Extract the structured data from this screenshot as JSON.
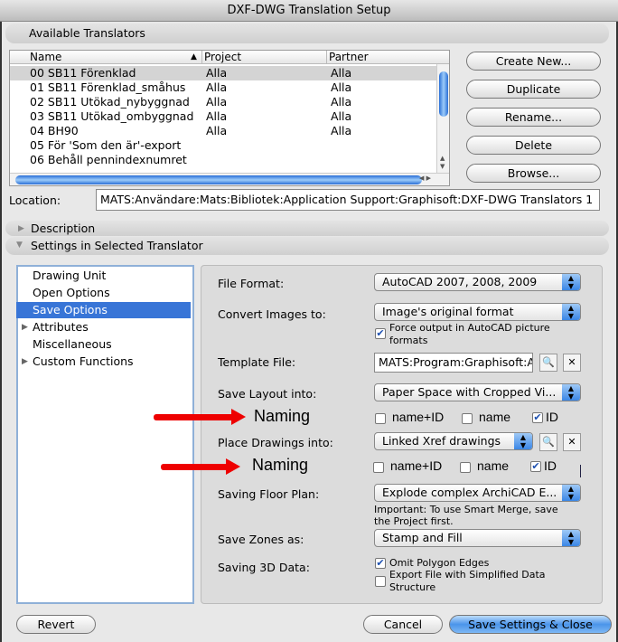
{
  "window": {
    "title": "DXF-DWG Translation Setup"
  },
  "available": {
    "header": "Available Translators",
    "columns": [
      "Name",
      "Project",
      "Partner"
    ],
    "rows": [
      {
        "name": "00 SB11 Förenklad",
        "project": "Alla",
        "partner": "Alla"
      },
      {
        "name": "01 SB11 Förenklad_småhus",
        "project": "Alla",
        "partner": "Alla"
      },
      {
        "name": "02 SB11 Utökad_nybyggnad",
        "project": "Alla",
        "partner": "Alla"
      },
      {
        "name": "03 SB11 Utökad_ombyggnad",
        "project": "Alla",
        "partner": "Alla"
      },
      {
        "name": "04 BH90",
        "project": "Alla",
        "partner": "Alla"
      },
      {
        "name": "05 För 'Som den är'-export",
        "project": "",
        "partner": ""
      },
      {
        "name": "06 Behåll pennindexnumret",
        "project": "",
        "partner": ""
      }
    ],
    "buttons": {
      "create": "Create New...",
      "duplicate": "Duplicate",
      "rename": "Rename...",
      "delete": "Delete",
      "browse": "Browse..."
    },
    "location_label": "Location:",
    "location_value": "MATS:Användare:Mats:Bibliotek:Application Support:Graphisoft:DXF-DWG Translators 1"
  },
  "sections": {
    "description": "Description",
    "settings": "Settings in Selected Translator"
  },
  "sidebar": {
    "items": [
      "Drawing Unit",
      "Open Options",
      "Save Options",
      "Attributes",
      "Miscellaneous",
      "Custom Functions"
    ]
  },
  "options": {
    "file_format": {
      "label": "File Format:",
      "value": "AutoCAD 2007, 2008, 2009"
    },
    "convert_images": {
      "label": "Convert Images to:",
      "value": "Image's original format",
      "checkbox": "Force output in AutoCAD picture formats"
    },
    "template": {
      "label": "Template File:",
      "value": "MATS:Program:Graphisoft:A"
    },
    "save_layout": {
      "label": "Save Layout into:",
      "value": "Paper Space with Cropped Vi..."
    },
    "naming1": {
      "label": "Naming",
      "opts": [
        "name+ID",
        "name",
        "ID"
      ]
    },
    "place_drawings": {
      "label": "Place Drawings into:",
      "value": "Linked Xref drawings"
    },
    "naming2": {
      "label": "Naming",
      "opts": [
        "name+ID",
        "name",
        "ID"
      ]
    },
    "floor_plan": {
      "label": "Saving Floor Plan:",
      "value": "Explode complex ArchiCAD E...",
      "note": "Important: To use Smart Merge, save the Project first."
    },
    "zones": {
      "label": "Save Zones as:",
      "value": "Stamp and Fill"
    },
    "data3d": {
      "label": "Saving 3D Data:",
      "omit": "Omit Polygon Edges",
      "export": "Export File with Simplified Data Structure"
    }
  },
  "footer": {
    "revert": "Revert",
    "cancel": "Cancel",
    "save": "Save Settings & Close"
  },
  "colors": {
    "accent": "#3875d7",
    "annotation": "#e00000"
  }
}
